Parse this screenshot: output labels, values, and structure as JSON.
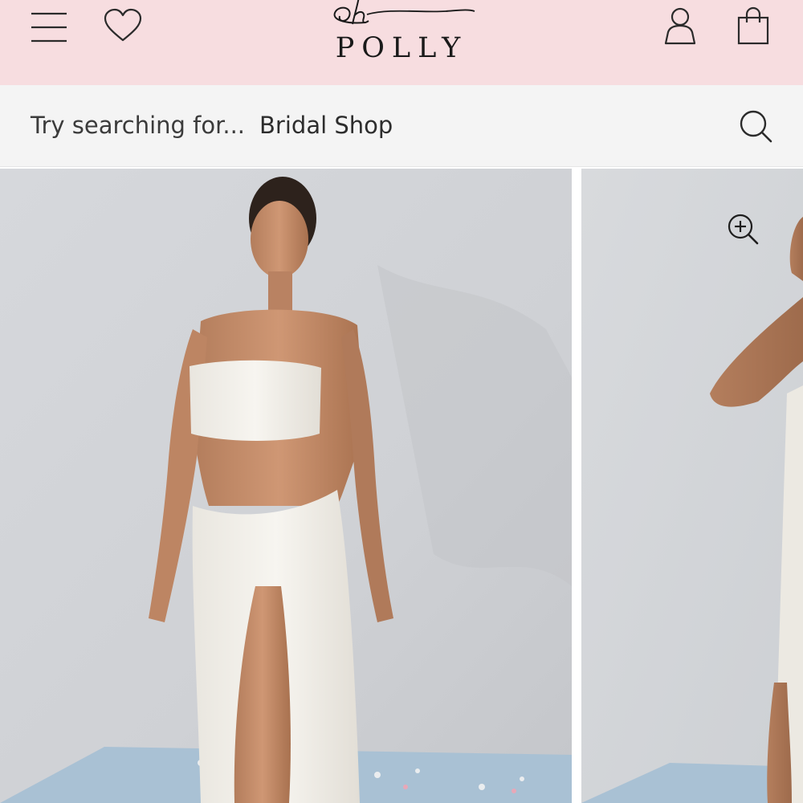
{
  "header": {
    "logo": {
      "script": "oh",
      "wordmark": "POLLY"
    },
    "icons": [
      "hamburger-menu-icon",
      "heart-icon",
      "account-icon",
      "shopping-bag-icon"
    ]
  },
  "search": {
    "prompt": "Try searching for...",
    "suggestion": "Bridal Shop",
    "icon": "search-icon"
  },
  "gallery": {
    "images": [
      "product-image-front",
      "product-image-side"
    ],
    "zoom_icon": "zoom-in-icon"
  },
  "colors": {
    "header_bg": "#f7dde0",
    "search_bg": "#f4f4f4",
    "icon": "#2b2b2b"
  }
}
